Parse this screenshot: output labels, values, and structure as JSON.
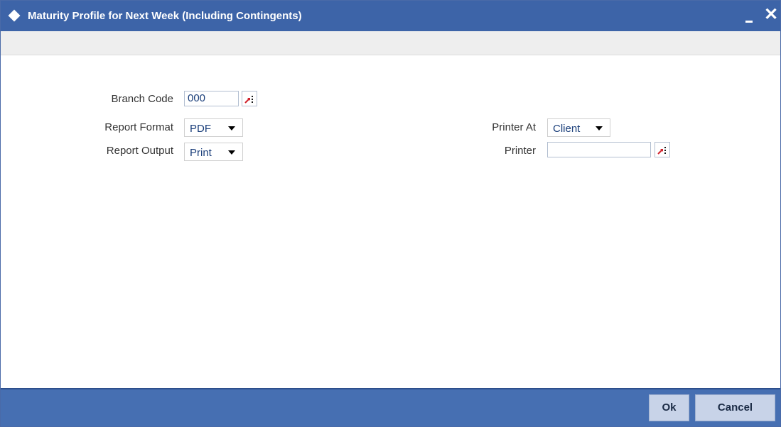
{
  "window": {
    "title": "Maturity Profile for Next Week (Including Contingents)",
    "title_icon": "diamond-icon",
    "minimize_icon": "minimize-icon",
    "close_icon": "close-icon",
    "close_glyph": "✕"
  },
  "form": {
    "branch_code": {
      "label": "Branch Code",
      "value": "000",
      "lov_icon": "lov-icon"
    },
    "report_format": {
      "label": "Report Format",
      "value": "PDF"
    },
    "report_output": {
      "label": "Report Output",
      "value": "Print"
    },
    "printer_at": {
      "label": "Printer At",
      "value": "Client"
    },
    "printer": {
      "label": "Printer",
      "value": "",
      "lov_icon": "lov-icon"
    }
  },
  "footer": {
    "ok_label": "Ok",
    "cancel_label": "Cancel"
  },
  "colors": {
    "titlebar": "#3d64a8",
    "footer": "#466fb2",
    "button": "#c8d3e8",
    "lov_arrow": "#d0202a"
  }
}
